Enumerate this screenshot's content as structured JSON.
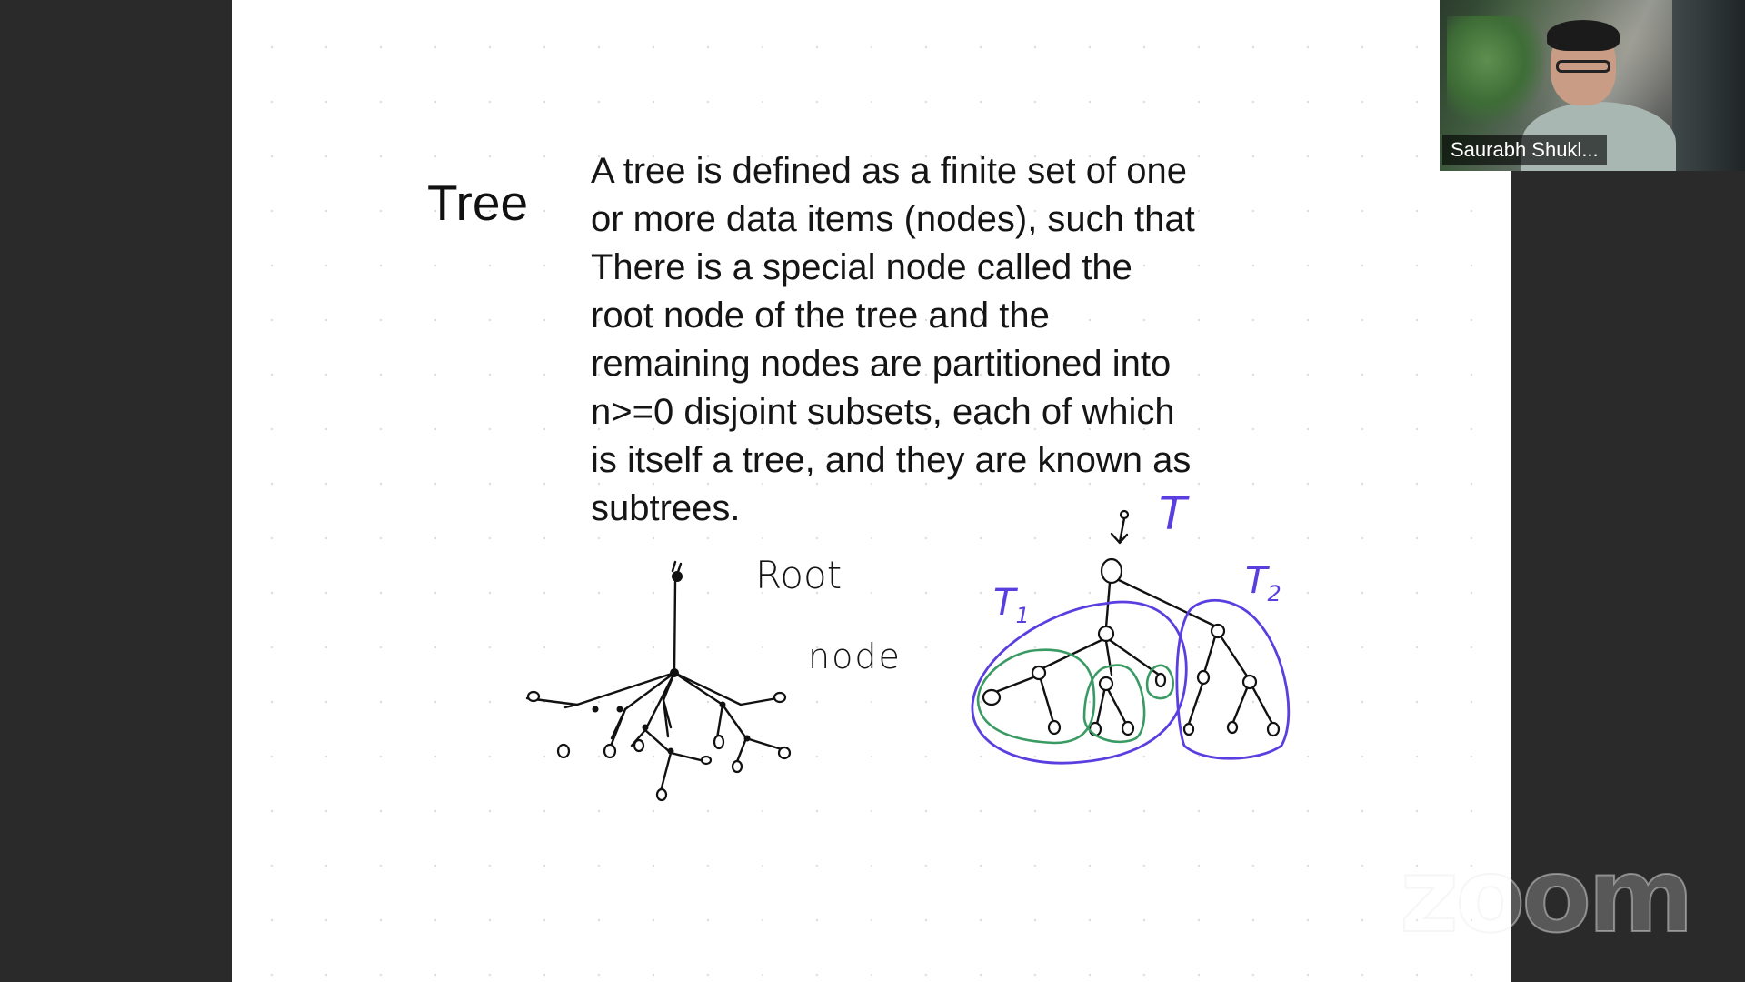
{
  "slide": {
    "heading": "Tree",
    "definition_lines": [
      "A tree is defined as a finite set of one",
      "or more data items (nodes), such that",
      "There is a special node called the",
      "root node of the tree and the",
      "remaining nodes are partitioned into",
      "n>=0 disjoint subsets, each of which",
      "is itself a tree, and they are known as",
      "subtrees."
    ],
    "annotations": {
      "root_label": "Root",
      "node_label": "node",
      "tree_label": "T",
      "subtree_1_label": "T",
      "subtree_1_subscript": "1",
      "subtree_2_label": "T",
      "subtree_2_subscript": "2"
    },
    "ink_colors": {
      "pen": "#111111",
      "subtree_outline": "#5b3ee0",
      "nested_outline": "#3a9a64"
    }
  },
  "participant": {
    "name": "Saurabh Shukl..."
  },
  "watermark": {
    "text": "zoom"
  }
}
